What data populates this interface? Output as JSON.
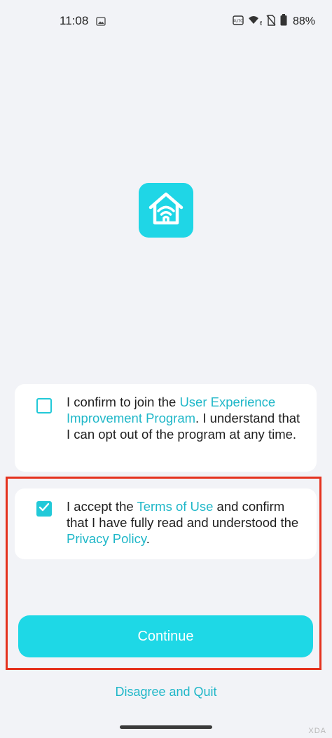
{
  "status_bar": {
    "time": "11:08",
    "battery": "88%",
    "icons": [
      "gallery-icon",
      "auto-brightness-icon",
      "wifi-6-icon",
      "no-sim-icon",
      "battery-icon"
    ]
  },
  "logo": {
    "icon": "home-wifi-icon",
    "color": "#1fd6e6"
  },
  "ux_program": {
    "checked": false,
    "text_before": "I confirm to join the ",
    "link_text": "User Experience Improvement Program",
    "text_after": ". I understand that I can opt out of the program at any time."
  },
  "terms": {
    "checked": true,
    "text_before": "I accept the ",
    "terms_link": "Terms of Use",
    "text_middle": " and confirm that I have fully read and understood the ",
    "privacy_link": "Privacy Policy",
    "text_after": "."
  },
  "continue_label": "Continue",
  "disagree_label": "Disagree and Quit",
  "watermark": "XDA",
  "colors": {
    "accent": "#1ed8e6",
    "link": "#1fb7c8",
    "highlight": "#e4321e",
    "background": "#f2f3f7"
  }
}
